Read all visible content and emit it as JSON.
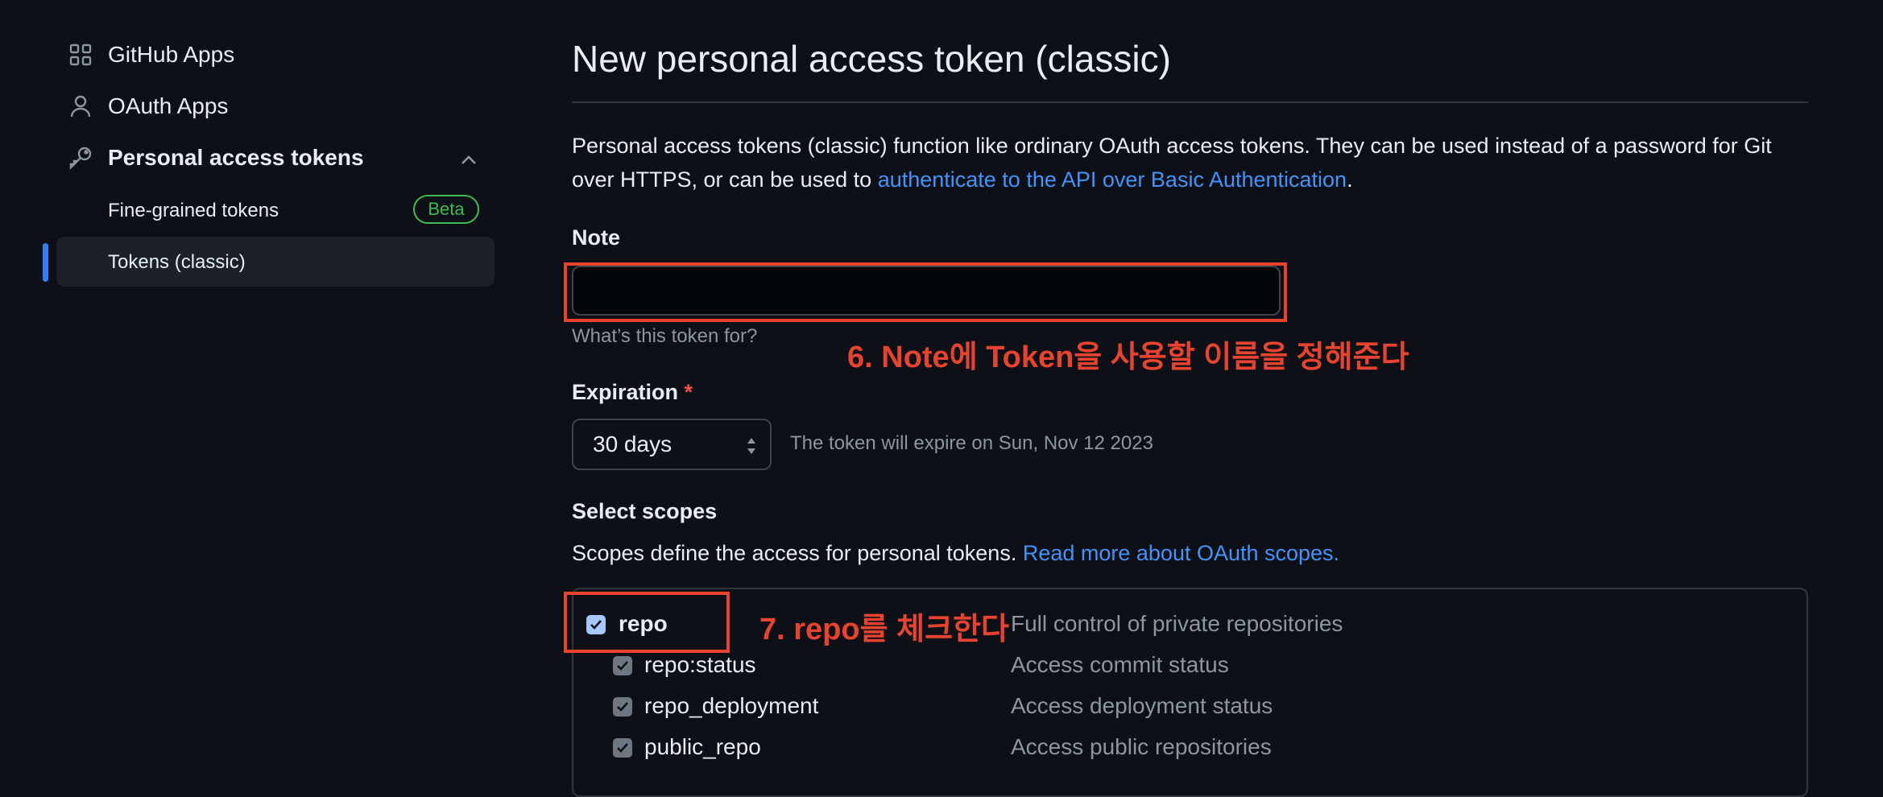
{
  "sidebar": {
    "items": [
      {
        "label": "GitHub Apps",
        "icon": "apps-grid-icon"
      },
      {
        "label": "OAuth Apps",
        "icon": "person-icon"
      },
      {
        "label": "Personal access tokens",
        "icon": "key-icon"
      }
    ],
    "sub_items": [
      {
        "label": "Fine-grained tokens",
        "badge": "Beta"
      },
      {
        "label": "Tokens (classic)"
      }
    ]
  },
  "main": {
    "title": "New personal access token (classic)",
    "description_pre": "Personal access tokens (classic) function like ordinary OAuth access tokens. They can be used instead of a password for Git over HTTPS, or can be used to ",
    "description_link": "authenticate to the API over Basic Authentication",
    "description_post": ".",
    "note": {
      "label": "Note",
      "value": "",
      "hint": "What’s this token for?"
    },
    "expiration": {
      "label": "Expiration",
      "required_mark": "*",
      "selected": "30 days",
      "info": "The token will expire on Sun, Nov 12 2023"
    },
    "scopes": {
      "label": "Select scopes",
      "text": "Scopes define the access for personal tokens. ",
      "link": "Read more about OAuth scopes.",
      "items": [
        {
          "name": "repo",
          "description": "Full control of private repositories",
          "checked": true
        },
        {
          "name": "repo:status",
          "description": "Access commit status",
          "checked": true
        },
        {
          "name": "repo_deployment",
          "description": "Access deployment status",
          "checked": true
        },
        {
          "name": "public_repo",
          "description": "Access public repositories",
          "checked": true
        }
      ]
    }
  },
  "annotations": {
    "note": "6. Note에 Token을 사용할 이름을 정해준다",
    "repo": "7. repo를 체크한다"
  },
  "colors": {
    "background": "#0d1117",
    "link": "#4493f8",
    "annotation": "#e8432f",
    "beta": "#3fb950",
    "selected_bar": "#2f81f7"
  }
}
